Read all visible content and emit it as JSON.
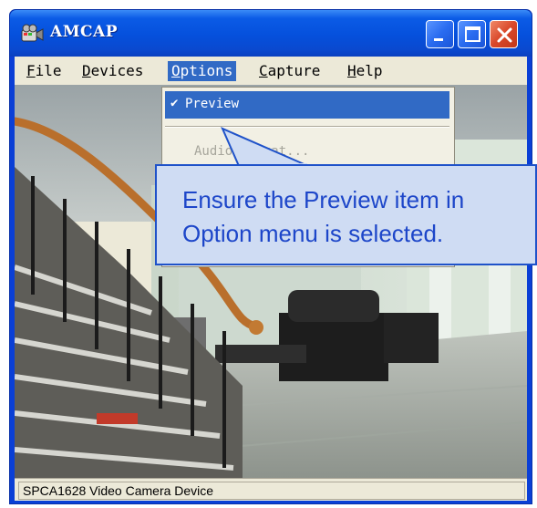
{
  "window": {
    "title": "AMCAP",
    "titlebar_color": "#0550dc"
  },
  "menubar": {
    "file": {
      "mnemonic": "F",
      "rest": "ile"
    },
    "devices": {
      "mnemonic": "D",
      "rest": "evices"
    },
    "options": {
      "mnemonic": "O",
      "rest": "ptions"
    },
    "capture": {
      "mnemonic": "C",
      "rest": "apture"
    },
    "help": {
      "mnemonic": "H",
      "rest": "elp"
    }
  },
  "options_menu": {
    "preview": {
      "check": "✔",
      "label": "Preview",
      "checked": true
    },
    "audio_label": "Audio Format..."
  },
  "callout": {
    "line1": "Ensure the Preview item in",
    "line2": "Option menu is selected."
  },
  "status": {
    "text": "SPCA1628 Video Camera Device"
  },
  "colors": {
    "menu_highlight": "#316ac5",
    "callout_fill": "#cfdcf3",
    "callout_border": "#1f52c9",
    "callout_text": "#1d46c9"
  },
  "icons": [
    "camera-icon",
    "minimize-icon",
    "maximize-icon",
    "close-icon",
    "checkmark-icon"
  ]
}
